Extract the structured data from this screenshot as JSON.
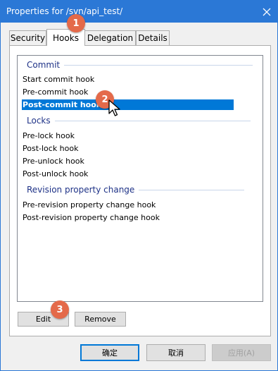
{
  "window": {
    "title": "Properties for /svn/api_test/",
    "close_icon": "close-icon",
    "titlebar_color": "#2b78d6"
  },
  "tabs": [
    {
      "label": "Security",
      "active": false
    },
    {
      "label": "Hooks",
      "active": true
    },
    {
      "label": "Delegation",
      "active": false
    },
    {
      "label": "Details",
      "active": false
    }
  ],
  "hooks": {
    "groups": [
      {
        "header": "Commit",
        "items": [
          "Start commit hook",
          "Pre-commit hook",
          "Post-commit hook"
        ]
      },
      {
        "header": "Locks",
        "items": [
          "Pre-lock hook",
          "Post-lock hook",
          "Pre-unlock hook",
          "Post-unlock hook"
        ]
      },
      {
        "header": "Revision property change",
        "items": [
          "Pre-revision property change hook",
          "Post-revision property change hook"
        ]
      }
    ],
    "selected_item": "Post-commit hook",
    "selection_color": "#0078d7"
  },
  "panel_buttons": {
    "edit_label": "Edit",
    "remove_label": "Remove"
  },
  "dialog_buttons": {
    "ok_label": "确定",
    "cancel_label": "取消",
    "apply_label": "应用(A)"
  },
  "annotations": {
    "badge1": "1",
    "badge2": "2",
    "badge3": "3",
    "badge_color": "#e46a4a"
  }
}
